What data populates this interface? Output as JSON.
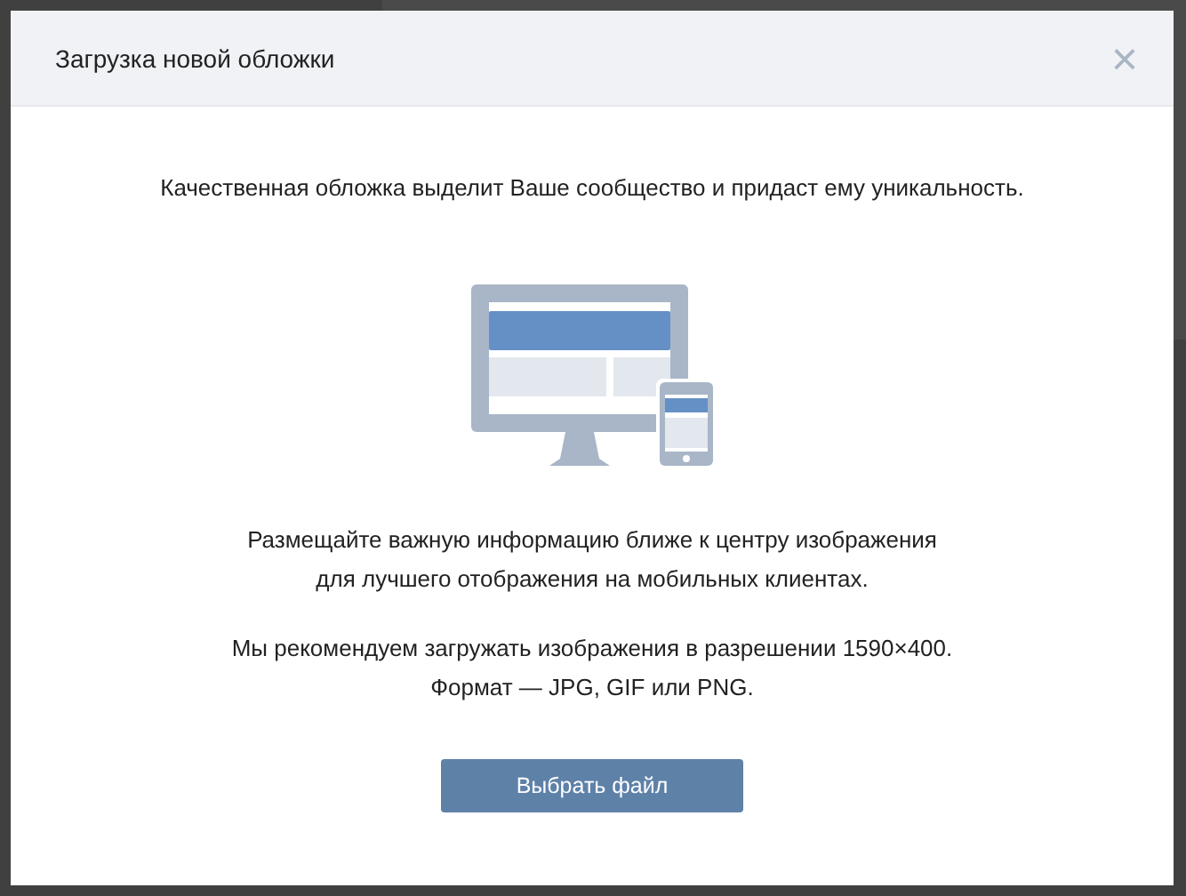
{
  "dialog": {
    "title": "Загрузка новой обложки",
    "close": "×",
    "intro": "Качественная обложка выделит Ваше сообщество и придаст ему уникальность.",
    "hint_lines": [
      "Размещайте важную информацию ближе к центру изображения",
      "для лучшего отображения на мобильных клиентах."
    ],
    "format_lines": [
      "Мы рекомендуем загружать изображения в разрешении 1590×400.",
      "Формат — JPG, GIF или PNG."
    ],
    "button": "Выбрать файл"
  }
}
